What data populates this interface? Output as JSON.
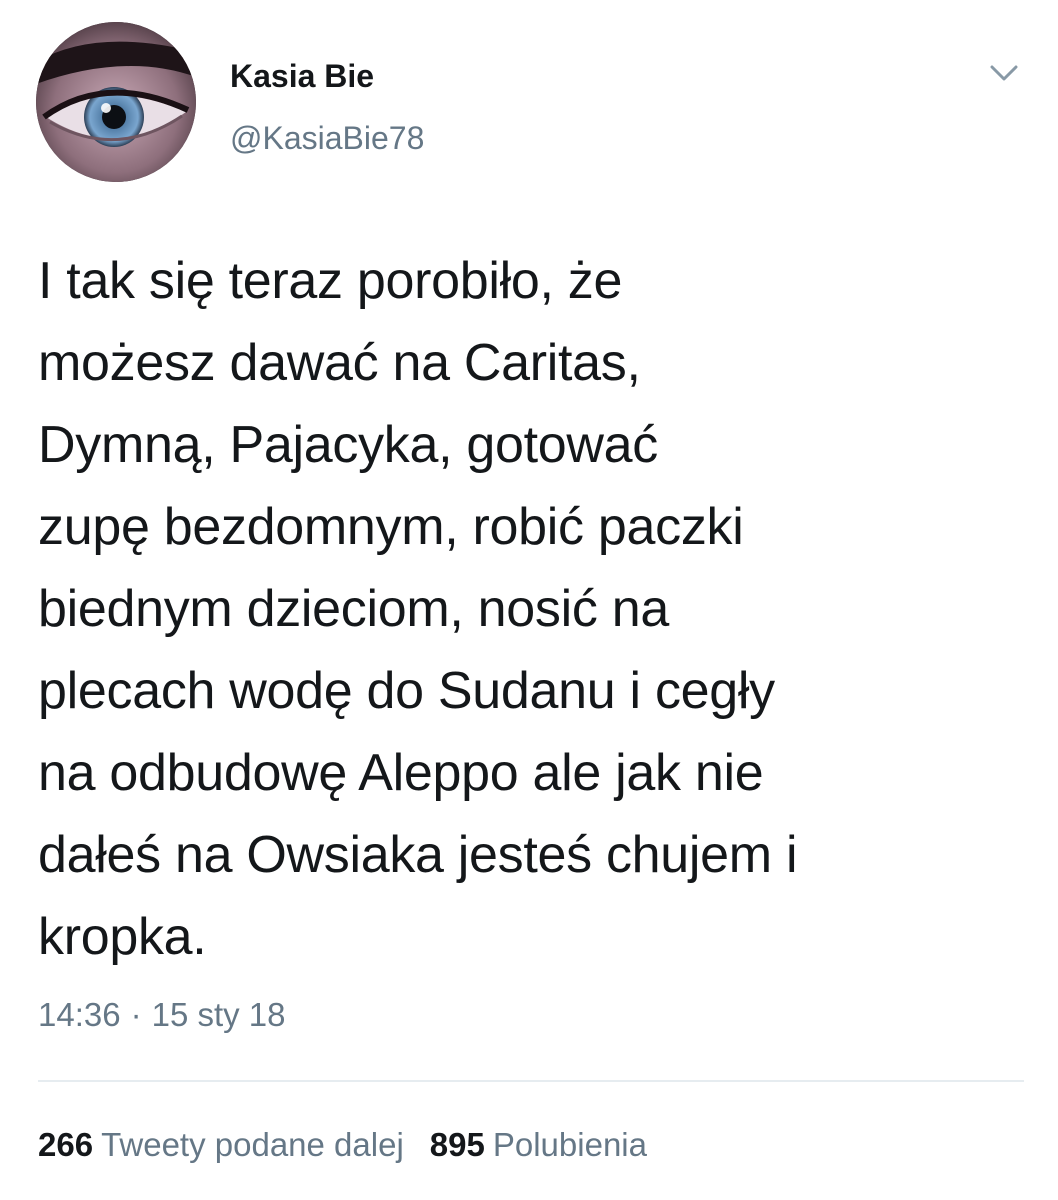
{
  "user": {
    "display_name": "Kasia Bie",
    "handle": "@KasiaBie78",
    "avatar_icon": "eye-closeup-avatar"
  },
  "menu": {
    "icon": "chevron-down-icon"
  },
  "tweet": {
    "text": "I tak się teraz porobiło, że\nmożesz dawać na Caritas,\nDymną, Pajacyka, gotować\nzupę bezdomnym, robić paczki\nbiednym dzieciom, nosić na\nplecach wodę do Sudanu i cegły\nna odbudowę Aleppo ale jak nie\ndałeś na Owsiaka jesteś chujem i\nkropka.",
    "time": "14:36",
    "separator": "·",
    "date": "15 sty 18"
  },
  "stats": {
    "retweets_count": "266",
    "retweets_label": "Tweety podane dalej",
    "likes_count": "895",
    "likes_label": "Polubienia"
  },
  "colors": {
    "text": "#14171a",
    "secondary": "#657786",
    "divider": "#e6ecf0"
  }
}
